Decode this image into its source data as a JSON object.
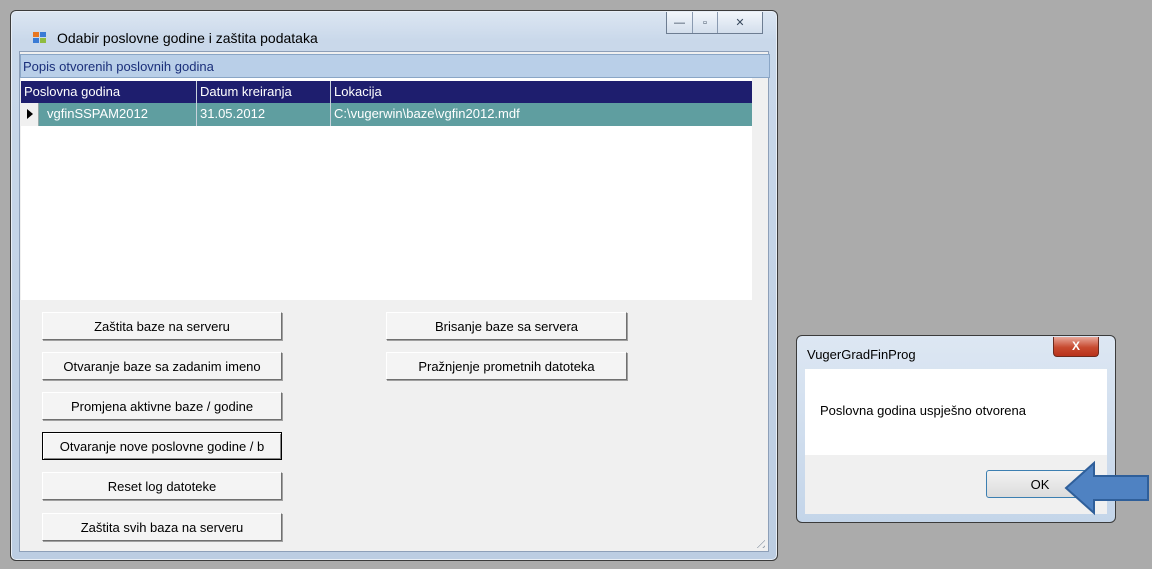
{
  "main_window": {
    "title": "Odabir poslovne godine i zaštita podataka",
    "controls": {
      "minimize": "—",
      "maximize": "▫",
      "close": "✕"
    }
  },
  "grid": {
    "caption": "Popis otvorenih poslovnih godina",
    "columns": [
      "Poslovna godina",
      "Datum kreiranja",
      "Lokacija"
    ],
    "rows": [
      [
        "vgfinSSPAM2012",
        "31.05.2012",
        "C:\\vugerwin\\baze\\vgfin2012.mdf"
      ]
    ]
  },
  "buttons": {
    "zastita_baze": "Zaštita baze na serveru",
    "otvaranje_zadanim": "Otvaranje baze sa zadanim imeno",
    "promjena_aktivne": "Promjena aktivne baze / godine",
    "otvaranje_nove": "Otvaranje nove poslovne godine / b",
    "reset_log": "Reset log datoteke",
    "zastita_svih": "Zaštita svih baza na serveru",
    "brisanje_baze": "Brisanje baze sa servera",
    "praznjenje": "Pražnjenje prometnih datoteka"
  },
  "message_box": {
    "title": "VugerGradFinProg",
    "close": "X",
    "text": "Poslovna godina uspješno otvorena",
    "ok": "OK"
  },
  "colors": {
    "grid_header": "#1e1e6e",
    "selected_row": "#5f9ea0",
    "arrow": "#4f82c2"
  }
}
